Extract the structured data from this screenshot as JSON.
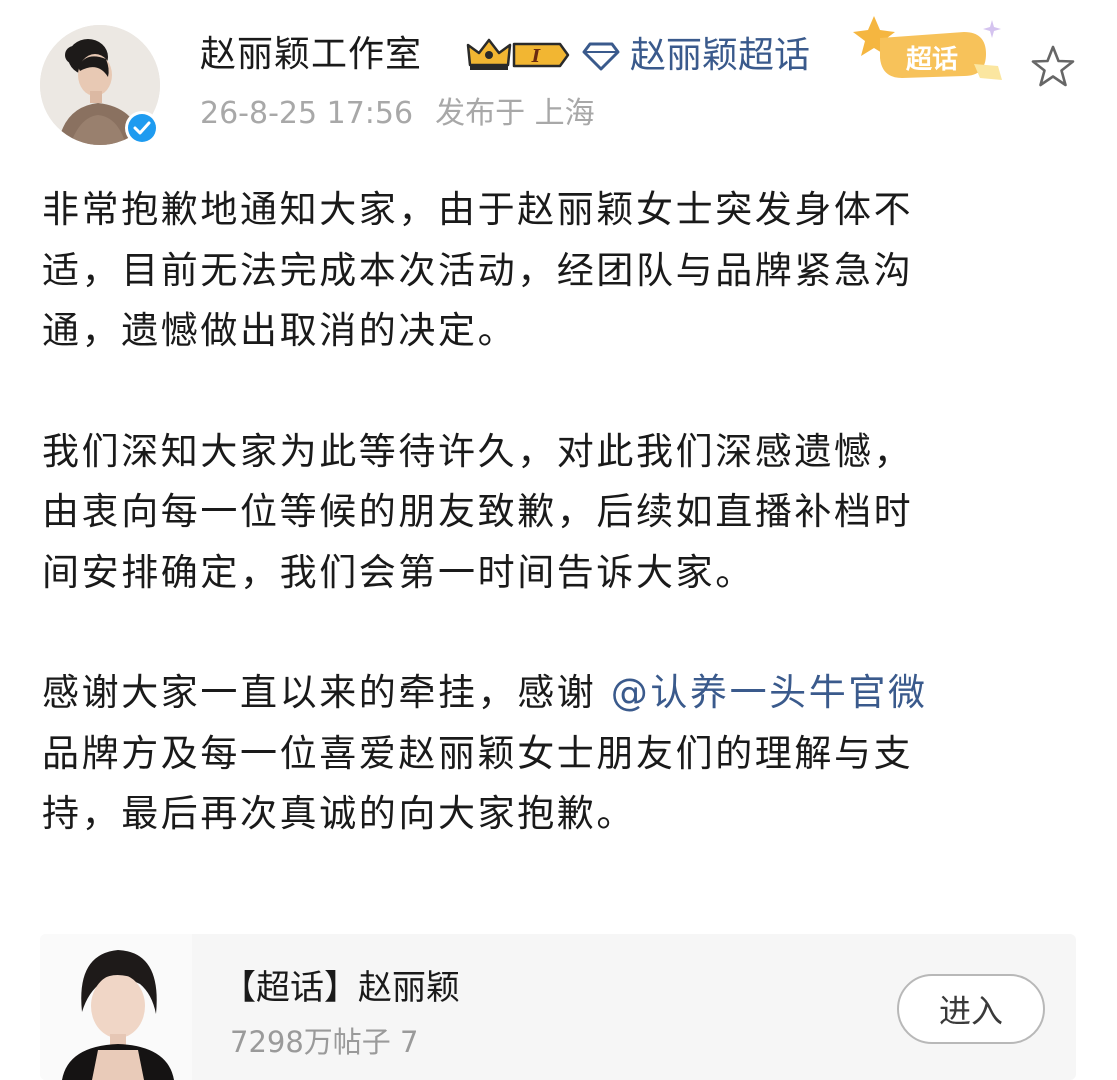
{
  "post": {
    "username": "赵丽颖工作室",
    "level_label": "I",
    "topic_link": "赵丽颖超话",
    "chaohua_badge": "超话",
    "date": "26-8-25 17:56",
    "location": "发布于 上海",
    "paragraphs": [
      [
        "非常抱歉地通知大家，由于赵丽颖女士突发身体不",
        "适，目前无法完成本次活动，经团队与品牌紧急沟",
        "通，遗憾做出取消的决定。"
      ],
      [
        "我们深知大家为此等待许久，对此我们深感遗憾，",
        "由衷向每一位等候的朋友致歉，后续如直播补档时",
        "间安排确定，我们会第一时间告诉大家。"
      ]
    ],
    "p3_line1_prefix": "感谢大家一直以来的牵挂，感谢 ",
    "mention": "@认养一头牛官微",
    "p3_line2": "品牌方及每一位喜爱赵丽颖女士朋友们的理解与支",
    "p3_line3": "持，最后再次真诚的向大家抱歉。"
  },
  "card": {
    "title": "【超话】赵丽颖",
    "stats": "7298万帖子 7",
    "enter_label": "进入"
  },
  "colors": {
    "link": "#3a5a8c",
    "verified": "#1e9bf0",
    "meta": "#a8a8a8",
    "badge_gold": "#f2b632"
  }
}
